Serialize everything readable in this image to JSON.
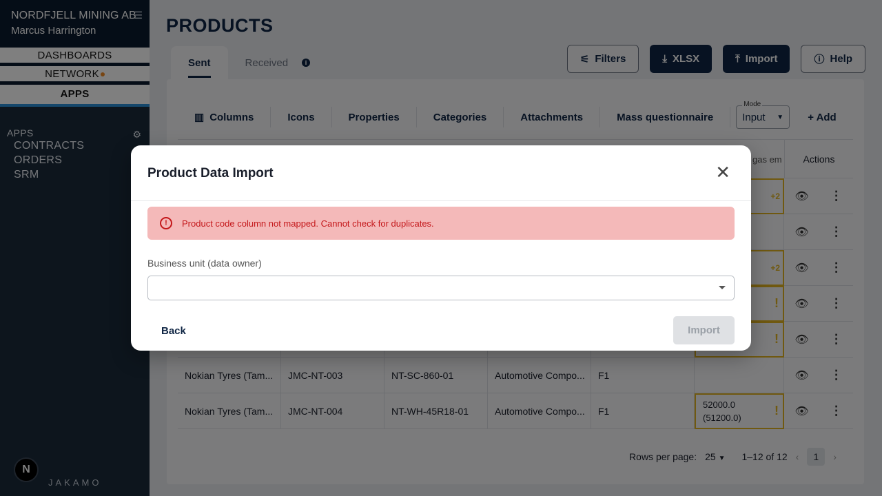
{
  "sidebar": {
    "company": "NORDFJELL MINING AB",
    "user": "Marcus Harrington",
    "nav": [
      {
        "label": "DASHBOARDS"
      },
      {
        "label": "NETWORK"
      },
      {
        "label": "APPS"
      }
    ],
    "apps_title": "APPS",
    "apps": [
      "CONTRACTS",
      "ORDERS",
      "SRM"
    ],
    "avatar_letter": "N",
    "logo": "JAKAMO"
  },
  "page": {
    "title": "PRODUCTS",
    "tabs": [
      {
        "label": "Sent"
      },
      {
        "label": "Received"
      }
    ],
    "buttons": {
      "filters": "Filters",
      "xlsx": "XLSX",
      "import": "Import",
      "help": "Help"
    }
  },
  "toolbar": {
    "items": [
      "Columns",
      "Icons",
      "Properties",
      "Categories",
      "Attachments",
      "Mass questionnaire"
    ],
    "mode_label": "Mode",
    "mode_value": "Input",
    "add_label": "Add"
  },
  "table": {
    "header_gas": "gas em",
    "header_actions": "Actions",
    "rows": [
      {
        "supplier": "Nokian Tyres (Tam...",
        "code": "JMC-NT-003",
        "sku": "NT-SC-860-01",
        "category": "Automotive Compo...",
        "unit": "F1",
        "value1": "",
        "value2": ""
      },
      {
        "supplier": "Nokian Tyres (Tam...",
        "code": "JMC-NT-004",
        "sku": "NT-WH-45R18-01",
        "category": "Automotive Compo...",
        "unit": "F1",
        "value1": "52000.0",
        "value2": "(51200.0)"
      }
    ],
    "badge_more": "+2",
    "rows_per_page_label": "Rows per page:",
    "rows_per_page": "25",
    "range": "1–12 of 12",
    "page": "1"
  },
  "modal": {
    "title": "Product Data Import",
    "alert": "Product code column not mapped. Cannot check for duplicates.",
    "field_label": "Business unit (data owner)",
    "back": "Back",
    "import": "Import"
  }
}
